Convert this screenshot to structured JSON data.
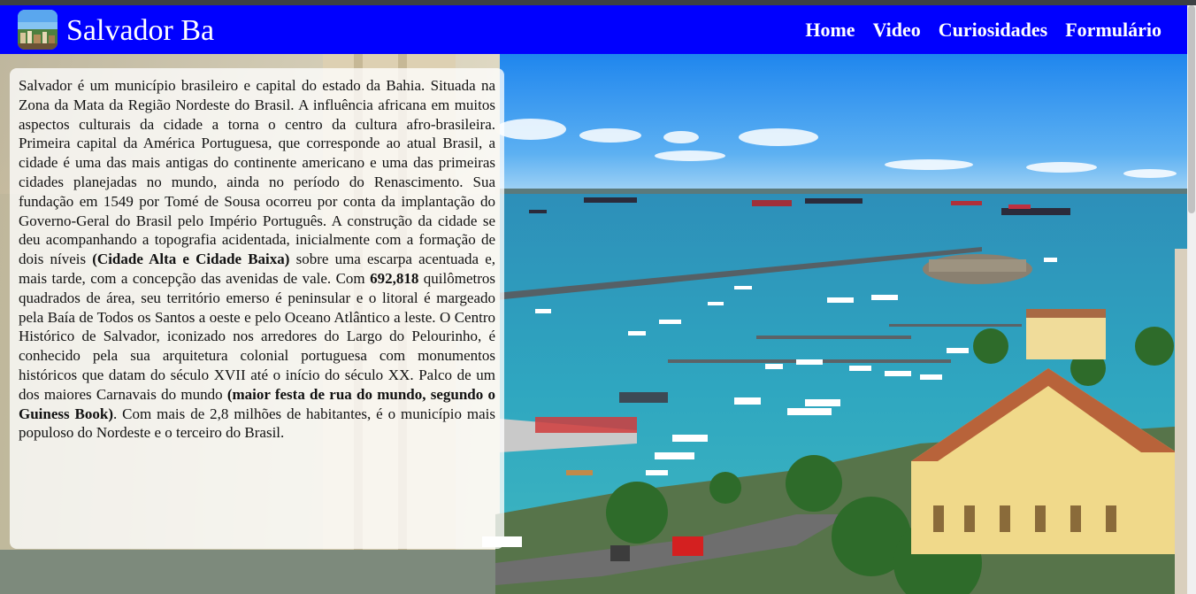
{
  "header": {
    "logo_icon": "city-photo-thumbnail-icon",
    "title": "Salvador Ba",
    "background_color": "#0000ff"
  },
  "nav": {
    "items": [
      {
        "label": "Home"
      },
      {
        "label": "Video"
      },
      {
        "label": "Curiosidades"
      },
      {
        "label": "Formulário"
      }
    ]
  },
  "hero": {
    "image_subject": "aerial-bay-harbor-photo"
  },
  "intro": {
    "t1": "Salvador é um município brasileiro e capital do estado da Bahia. Situada na Zona da Mata da Região Nordeste do Brasil. A influência africana em muitos aspectos culturais da cidade a torna o centro da cultura afro-brasileira. Primeira capital da América Portuguesa, que corresponde ao atual Brasil, a cidade é uma das mais antigas do continente americano e uma das primeiras cidades planejadas no mundo, ainda no período do Renascimento. Sua fundação em 1549 por Tomé de Sousa ocorreu por conta da implantação do Governo-Geral do Brasil pelo Império Português. A construção da cidade se deu acompanhando a topografia acidentada, inicialmente com a formação de dois níveis ",
    "b1": "(Cidade Alta e Cidade Baixa)",
    "t2": " sobre uma escarpa acentuada e, mais tarde, com a concepção das avenidas de vale. Com ",
    "b2": "692,818",
    "t3": " quilômetros quadrados de área, seu território emerso é peninsular e o litoral é margeado pela Baía de Todos os Santos a oeste e pelo Oceano Atlântico a leste. O Centro Histórico de Salvador, iconizado nos arredores do Largo do Pelourinho, é conhecido pela sua arquitetura colonial portuguesa com monumentos históricos que datam do século XVII até o início do século XX. Palco de um dos maiores Carnavais do mundo ",
    "b3": "(maior festa de rua do mundo, segundo o Guiness Book)",
    "t4": ". Com mais de 2,8 milhões de habitantes, é o município mais populoso do Nordeste e o terceiro do Brasil."
  }
}
